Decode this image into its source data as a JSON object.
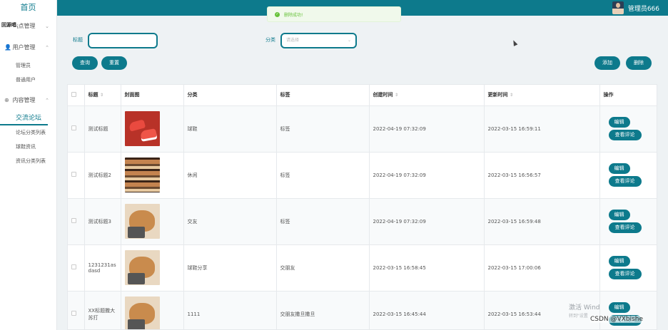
{
  "sidebar": {
    "brand": "首页",
    "overlay_tag": "回源唱",
    "groups": [
      {
        "label": "站点管理",
        "chevron": "⌄",
        "items": []
      },
      {
        "label": "用户管理",
        "chevron": "⌃",
        "items": [
          "管理员",
          "普通用户"
        ]
      },
      {
        "label": "内容管理",
        "chevron": "⌃",
        "items": [
          "交流论坛",
          "论坛分类列表",
          "球鞋资讯",
          "资讯分类列表"
        ],
        "active": "交流论坛"
      }
    ]
  },
  "header": {
    "admin_name": "管理员666",
    "accent": "#0d7a8c"
  },
  "toast": {
    "text": "删除成功!",
    "color": "#67c23a"
  },
  "search": {
    "title_label": "标题",
    "title_value": "",
    "category_label": "分类",
    "category_placeholder": "请选择",
    "query_button": "查询",
    "reset_button": "重置",
    "add_button": "添加",
    "delete_button": "删除"
  },
  "table": {
    "columns": [
      "标题",
      "封面图",
      "分类",
      "标签",
      "创建时间",
      "更新时间",
      "操作"
    ],
    "sortable": [
      "标题",
      "创建时间",
      "更新时间"
    ],
    "edit_label": "编辑",
    "comments_label": "查看评论",
    "rows": [
      {
        "title": "测试标题",
        "cover": "shoes",
        "category": "球鞋",
        "tag": "标签",
        "created": "2022-04-19 07:32:09",
        "updated": "2022-03-15 16:59:11"
      },
      {
        "title": "测试标题2",
        "cover": "rack",
        "category": "休闲",
        "tag": "标签",
        "created": "2022-04-19 07:32:09",
        "updated": "2022-03-15 16:56:57"
      },
      {
        "title": "测试标题3",
        "cover": "dog",
        "category": "交友",
        "tag": "标签",
        "created": "2022-04-19 07:32:09",
        "updated": "2022-03-15 16:59:48"
      },
      {
        "title": "1231231asdasd",
        "cover": "dog",
        "category": "球鞋分享",
        "tag": "交朋友",
        "created": "2022-03-15 16:58:45",
        "updated": "2022-03-15 17:00:06"
      },
      {
        "title": "XX标题撒大苏打",
        "cover": "dog",
        "category": "1111",
        "tag": "交朋友撒旦撒旦",
        "created": "2022-03-15 16:45:44",
        "updated": "2022-03-15 16:53:44"
      }
    ]
  },
  "watermarks": {
    "windows_line1": "激活 Wind",
    "windows_line2": "转到\"设置",
    "csdn": "CSDN @VXbishe"
  }
}
